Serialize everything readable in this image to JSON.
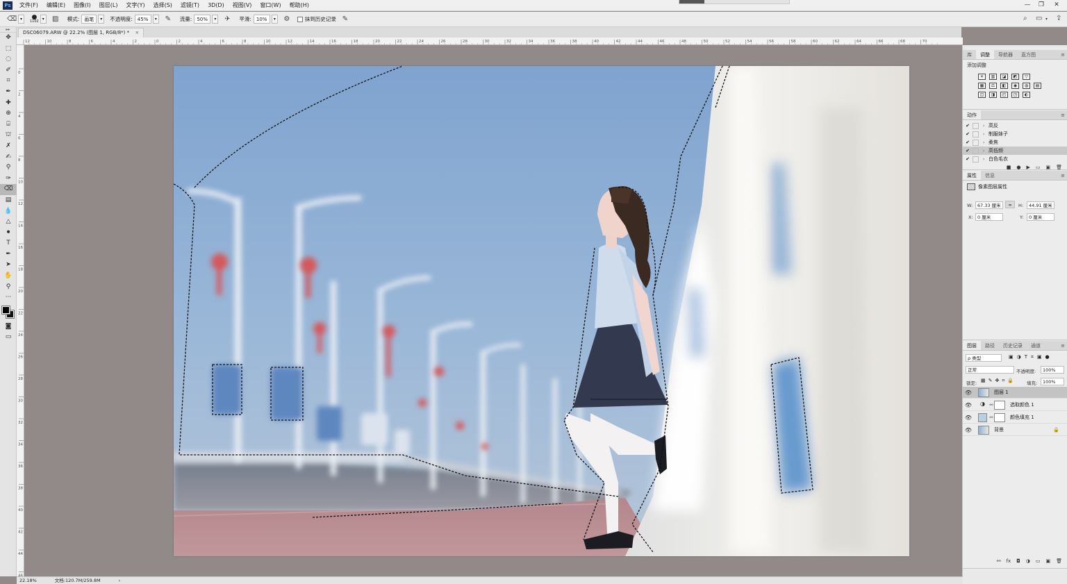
{
  "menubar": {
    "app_logo": "Ps",
    "items": [
      "文件(F)",
      "编辑(E)",
      "图像(I)",
      "图层(L)",
      "文字(Y)",
      "选择(S)",
      "滤镜(T)",
      "3D(D)",
      "视图(V)",
      "窗口(W)",
      "帮助(H)"
    ],
    "window_controls": [
      "—",
      "❐",
      "✕"
    ]
  },
  "options": {
    "brush_size": "1102",
    "mode_label": "模式:",
    "mode_value": "画笔",
    "opacity_label": "不透明度:",
    "opacity_value": "45%",
    "flow_label": "流量:",
    "flow_value": "50%",
    "smooth_label": "平滑:",
    "smooth_value": "10%",
    "erase_history_label": "抹到历史记录"
  },
  "document": {
    "tab_title": "DSC06079.ARW @ 22.2% (图层 1, RGB/8*) *",
    "close": "×"
  },
  "tools": [
    "move",
    "marquee",
    "lasso",
    "quick-select",
    "crop",
    "eyedropper",
    "spot-heal",
    "heal",
    "brush-patch",
    "stamp",
    "mixer",
    "history-brush",
    "eraser",
    "gradient",
    "blur",
    "dodge",
    "pen",
    "text",
    "path-select",
    "shape",
    "hand",
    "zoom",
    "more"
  ],
  "ruler": {
    "top": [
      "12",
      "10",
      "8",
      "6",
      "4",
      "2",
      "0",
      "2",
      "4",
      "6",
      "8",
      "10",
      "12",
      "14",
      "16",
      "18",
      "20",
      "22",
      "24",
      "26",
      "28",
      "30",
      "32",
      "34",
      "36",
      "38",
      "40",
      "42",
      "44",
      "46",
      "48",
      "50",
      "52",
      "54",
      "56",
      "58",
      "60",
      "62",
      "64",
      "66",
      "68",
      "70"
    ],
    "left": [
      "0",
      "2",
      "4",
      "6",
      "8",
      "10",
      "12",
      "14",
      "16",
      "18",
      "20",
      "22",
      "24",
      "26",
      "28",
      "30",
      "32",
      "34",
      "36",
      "38",
      "40",
      "42",
      "44",
      "46"
    ]
  },
  "panels": {
    "top_tabs": [
      "库",
      "调整",
      "导航器",
      "直方图"
    ],
    "adjust_title": "添加调整",
    "adjust_icons_row1": [
      "☀",
      "▥",
      "◪",
      "◩",
      "▽"
    ],
    "adjust_icons_row2": [
      "▦",
      "⚖",
      "◧",
      "◉",
      "◍",
      "▤"
    ],
    "adjust_icons_row3": [
      "◫",
      "◨",
      "◰",
      "◳",
      "◐"
    ],
    "actions_tab": "动作",
    "actions": [
      {
        "checked": "✔",
        "name": "高反",
        "selected": false
      },
      {
        "checked": "✔",
        "name": "制服妹子",
        "selected": false
      },
      {
        "checked": "✔",
        "name": "柔焦",
        "selected": false
      },
      {
        "checked": "✔",
        "name": "高低频",
        "selected": true
      },
      {
        "checked": "✔",
        "name": "白色毛衣",
        "selected": false
      }
    ],
    "action_controls": [
      "■",
      "●",
      "▶",
      "▭",
      "▣",
      "🗑"
    ],
    "props_tabs": [
      "属性",
      "信息"
    ],
    "props_title": "像素图层属性",
    "props": {
      "w_label": "W:",
      "w_value": "67.33 厘米",
      "h_label": "H:",
      "h_value": "44.91 厘米",
      "x_label": "X:",
      "x_value": "0 厘米",
      "y_label": "Y:",
      "y_value": "0 厘米",
      "link": "∞"
    },
    "layers_tabs": [
      "图层",
      "路径",
      "历史记录",
      "通道"
    ],
    "layers_filter": "ρ 类型",
    "blend_mode": "正常",
    "opacity_label": "不透明度:",
    "opacity_value": "100%",
    "lock_label": "锁定:",
    "fill_label": "填充:",
    "fill_value": "100%",
    "layers": [
      {
        "name": "图层 1",
        "selected": true
      },
      {
        "name": "选取颜色 1",
        "selected": false
      },
      {
        "name": "颜色填充 1",
        "selected": false
      },
      {
        "name": "背景",
        "selected": false,
        "locked": "🔒"
      }
    ],
    "layer_controls": [
      "⚯",
      "fx",
      "◘",
      "◑",
      "▭",
      "▣",
      "🗑"
    ]
  },
  "status": {
    "zoom": "22.18%",
    "doc_info": "文档:120.7M/259.8M",
    "arrow": "›"
  },
  "colors": {
    "canvas_bg": "#918a89",
    "sky": "#8fb0d6",
    "bridge_white": "#eeedea",
    "pavement": "#a98389"
  }
}
